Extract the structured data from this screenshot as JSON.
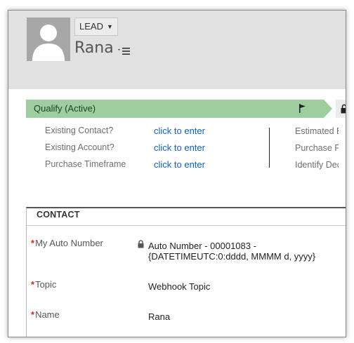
{
  "header": {
    "record_type": "LEAD",
    "record_name": "Rana"
  },
  "process": {
    "stage_label": "Qualify (Active)",
    "fields": [
      {
        "label": "Existing Contact?",
        "value": "click to enter"
      },
      {
        "label": "Existing Account?",
        "value": "click to enter"
      },
      {
        "label": "Purchase Timeframe",
        "value": "click to enter"
      }
    ],
    "right_fields": [
      "Estimated Bu",
      "Purchase Pro",
      "Identify Deci"
    ]
  },
  "contact_section": {
    "title": "CONTACT",
    "fields": [
      {
        "label": "My Auto Number",
        "required_mark": "*",
        "value_line1": "Auto Number - 00001083 -",
        "value_line2": "{DATETIMEUTC:0:dddd, MMMM d, yyyy}"
      },
      {
        "label": "Topic",
        "required_mark": "*",
        "value": "Webhook Topic"
      },
      {
        "label": "Name",
        "required_mark": "*",
        "value": "Rana"
      }
    ]
  },
  "colors": {
    "header_bg": "#e1e1e1",
    "stage_active": "#9ecea0",
    "link": "#1560bd",
    "required": "#d22222"
  },
  "icons": [
    "avatar-placeholder-icon",
    "caret-down-icon",
    "list-menu-icon",
    "flag-icon",
    "lock-icon"
  ]
}
